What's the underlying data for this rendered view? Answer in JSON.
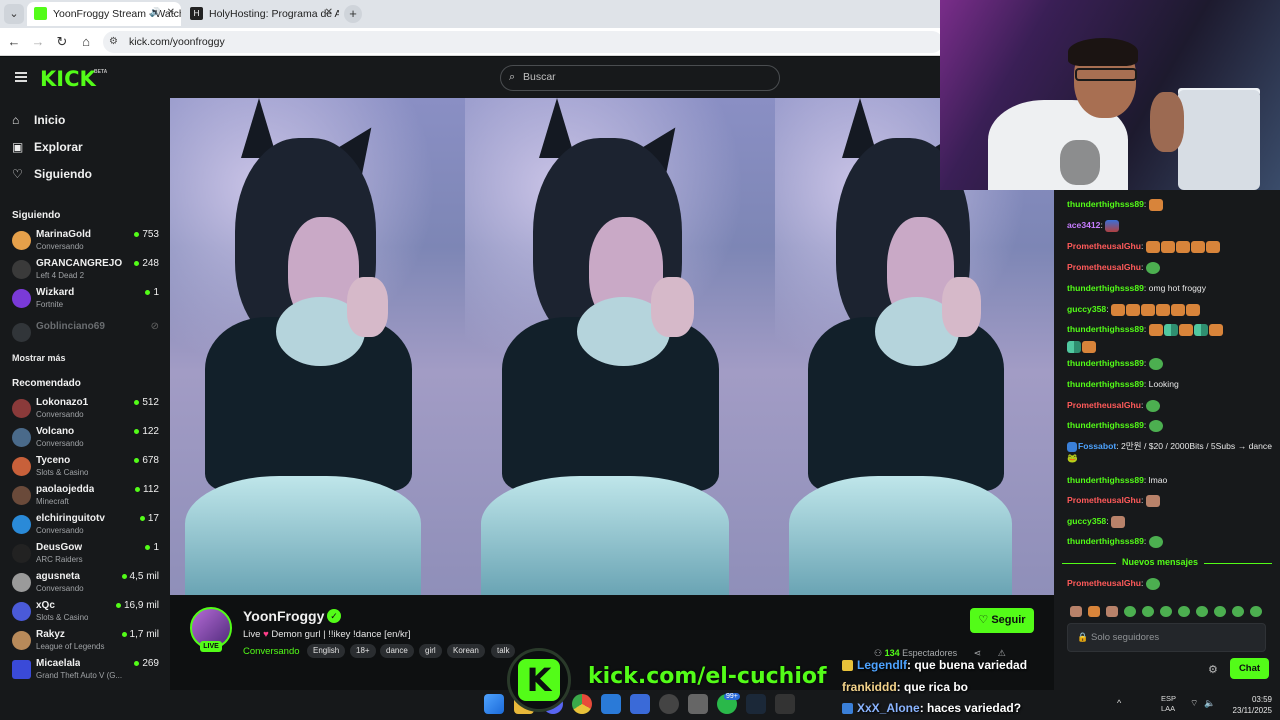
{
  "browser": {
    "tabs": [
      {
        "title": "YoonFroggy Stream - Watch",
        "active": true
      },
      {
        "title": "HolyHosting: Programa de Afili",
        "active": false
      }
    ],
    "url": "kick.com/yoonfroggy"
  },
  "site": {
    "logo": "KICK",
    "logo_badge": "BETA",
    "search_placeholder": "Buscar",
    "accent": "#53fc18"
  },
  "nav": [
    {
      "label": "Inicio",
      "icon": "home-icon"
    },
    {
      "label": "Explorar",
      "icon": "compass-icon"
    },
    {
      "label": "Siguiendo",
      "icon": "heart-icon"
    }
  ],
  "following": {
    "title": "Siguiendo",
    "channels": [
      {
        "name": "MarinaGold",
        "category": "Conversando",
        "viewers": "753"
      },
      {
        "name": "GRANCANGREJO",
        "category": "Left 4 Dead 2",
        "viewers": "248"
      },
      {
        "name": "Wizkard",
        "category": "Fortnite",
        "viewers": "1"
      },
      {
        "name": "Goblinciano69",
        "category": "",
        "viewers": ""
      }
    ],
    "show_more": "Mostrar más"
  },
  "recommended": {
    "title": "Recomendado",
    "channels": [
      {
        "name": "Lokonazo1",
        "category": "Conversando",
        "viewers": "512"
      },
      {
        "name": "Volcano",
        "category": "Conversando",
        "viewers": "122"
      },
      {
        "name": "Tyceno",
        "category": "Slots & Casino",
        "viewers": "678"
      },
      {
        "name": "paolaojedda",
        "category": "Minecraft",
        "viewers": "112"
      },
      {
        "name": "elchiringuitotv",
        "category": "Conversando",
        "viewers": "17"
      },
      {
        "name": "DeusGow",
        "category": "ARC Raiders",
        "viewers": "1"
      },
      {
        "name": "agusneta",
        "category": "Conversando",
        "viewers": "4,5 mil"
      },
      {
        "name": "xQc",
        "category": "Slots & Casino",
        "viewers": "16,9 mil"
      },
      {
        "name": "Rakyz",
        "category": "League of Legends",
        "viewers": "1,7 mil"
      },
      {
        "name": "Micaelala",
        "category": "Grand Theft Auto V (G...",
        "viewers": "269"
      }
    ]
  },
  "stream": {
    "streamer": "YoonFroggy",
    "title_prefix": "Live",
    "title_rest": "Demon gurl | !!ikey !dance [en/kr]",
    "category": "Conversando",
    "live_label": "LIVE",
    "tags": [
      "English",
      "18+",
      "dance",
      "girl",
      "Korean",
      "talk"
    ],
    "follow_label": "Seguir",
    "viewers_count": "134",
    "viewers_label": "Espectadores"
  },
  "chat": {
    "messages": [
      {
        "user": "thunderthighsss89",
        "text": "",
        "color": "#53fc18",
        "emotes": [
          "cat"
        ]
      },
      {
        "user": "ace3412",
        "text": "",
        "color": "#c77dff",
        "emotes": [
          "blue"
        ]
      },
      {
        "user": "PrometheusalGhu",
        "text": "",
        "color": "#ff5a5a",
        "emotes": [
          "cat",
          "cat",
          "cat",
          "cat",
          "cat"
        ]
      },
      {
        "user": "PrometheusalGhu",
        "text": "",
        "color": "#ff5a5a",
        "emotes": [
          "pepe"
        ]
      },
      {
        "user": "thunderthighsss89",
        "text": "omg hot froggy",
        "color": "#53fc18",
        "emotes": []
      },
      {
        "user": "guccy358",
        "text": "",
        "color": "#53fc18",
        "emotes": [
          "cat",
          "cat",
          "cat",
          "cat",
          "cat",
          "cat"
        ]
      },
      {
        "user": "thunderthighsss89",
        "text": "",
        "color": "#53fc18",
        "emotes": [
          "cat",
          "bars",
          "cat",
          "bars",
          "cat"
        ]
      },
      {
        "user": "",
        "text": "",
        "color": "#53fc18",
        "emotes": [
          "bars",
          "cat"
        ]
      },
      {
        "user": "thunderthighsss89",
        "text": "",
        "color": "#53fc18",
        "emotes": [
          "pepe"
        ]
      },
      {
        "user": "thunderthighsss89",
        "text": "Looking",
        "color": "#53fc18",
        "emotes": []
      },
      {
        "user": "PrometheusalGhu",
        "text": "",
        "color": "#ff5a5a",
        "emotes": [
          "pepe"
        ]
      },
      {
        "user": "thunderthighsss89",
        "text": "",
        "color": "#53fc18",
        "emotes": [
          "pepe"
        ]
      },
      {
        "user": "Fossabot",
        "text": "2만원 / $20 / 2000Bits / 5Subs → dance 🐸",
        "color": "#4da3ff",
        "emotes": []
      },
      {
        "user": "thunderthighsss89",
        "text": "lmao",
        "color": "#53fc18",
        "emotes": []
      },
      {
        "user": "PrometheusalGhu",
        "text": "",
        "color": "#ff5a5a",
        "emotes": [
          "face"
        ]
      },
      {
        "user": "guccy358",
        "text": "",
        "color": "#53fc18",
        "emotes": [
          "face"
        ]
      },
      {
        "user": "thunderthighsss89",
        "text": "",
        "color": "#53fc18",
        "emotes": [
          "pepe"
        ]
      }
    ],
    "new_messages": "Nuevos mensajes",
    "after_new": {
      "user": "PrometheusalGhu",
      "color": "#ff5a5a"
    },
    "input_placeholder": "Solo seguidores",
    "send_label": "Chat"
  },
  "overlay": {
    "kick_letter": "K",
    "kick_url": "kick.com/el-cuchiof",
    "messages": [
      {
        "user": "Legendlf",
        "text": ": que buena variedad"
      },
      {
        "user": "frankiddd",
        "text": ": que rica bo"
      },
      {
        "user": "XxX_Alone",
        "text": ": haces variedad?"
      }
    ]
  },
  "taskbar": {
    "language": "ESP",
    "layout": "LAA",
    "time": "03:59",
    "date": "23/11/2025",
    "badge": "99+"
  }
}
